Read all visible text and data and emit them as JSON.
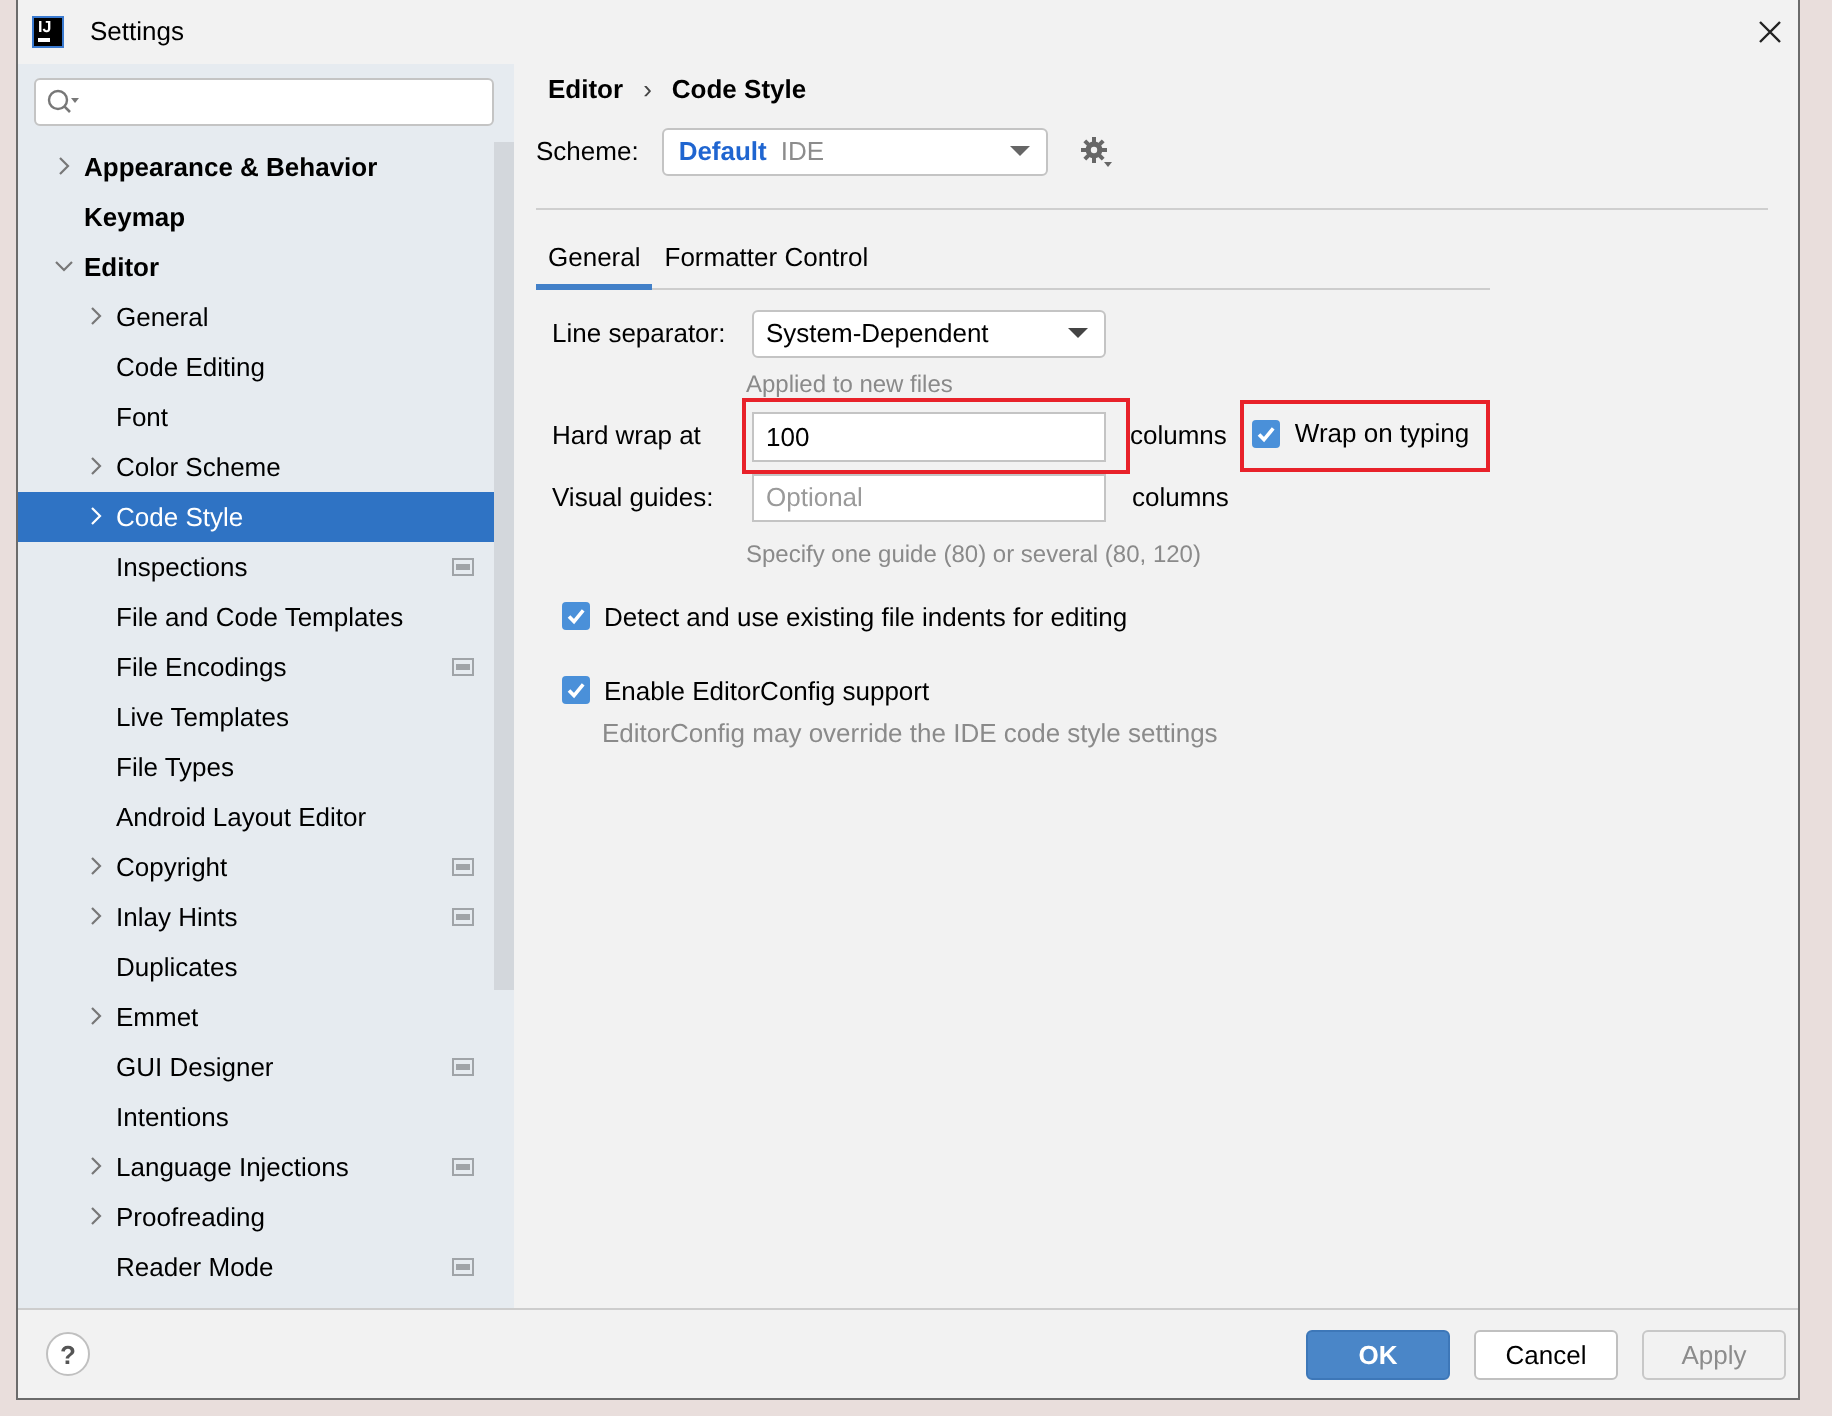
{
  "window": {
    "title": "Settings",
    "logo_text": "IJ"
  },
  "sidebar": {
    "items": [
      {
        "label": "Appearance & Behavior",
        "expandable": true,
        "expanded": false,
        "selected": false,
        "project_level": false
      },
      {
        "label": "Keymap",
        "expandable": false,
        "selected": false,
        "project_level": false
      },
      {
        "label": "Editor",
        "expandable": true,
        "expanded": true,
        "selected": false,
        "project_level": false,
        "children": [
          {
            "label": "General",
            "expandable": true,
            "expanded": false,
            "selected": false,
            "project_level": false
          },
          {
            "label": "Code Editing",
            "expandable": false,
            "selected": false,
            "project_level": false
          },
          {
            "label": "Font",
            "expandable": false,
            "selected": false,
            "project_level": false
          },
          {
            "label": "Color Scheme",
            "expandable": true,
            "expanded": false,
            "selected": false,
            "project_level": false
          },
          {
            "label": "Code Style",
            "expandable": true,
            "expanded": false,
            "selected": true,
            "project_level": false
          },
          {
            "label": "Inspections",
            "expandable": false,
            "selected": false,
            "project_level": true
          },
          {
            "label": "File and Code Templates",
            "expandable": false,
            "selected": false,
            "project_level": false
          },
          {
            "label": "File Encodings",
            "expandable": false,
            "selected": false,
            "project_level": true
          },
          {
            "label": "Live Templates",
            "expandable": false,
            "selected": false,
            "project_level": false
          },
          {
            "label": "File Types",
            "expandable": false,
            "selected": false,
            "project_level": false
          },
          {
            "label": "Android Layout Editor",
            "expandable": false,
            "selected": false,
            "project_level": false
          },
          {
            "label": "Copyright",
            "expandable": true,
            "expanded": false,
            "selected": false,
            "project_level": true
          },
          {
            "label": "Inlay Hints",
            "expandable": true,
            "expanded": false,
            "selected": false,
            "project_level": true
          },
          {
            "label": "Duplicates",
            "expandable": false,
            "selected": false,
            "project_level": false
          },
          {
            "label": "Emmet",
            "expandable": true,
            "expanded": false,
            "selected": false,
            "project_level": false
          },
          {
            "label": "GUI Designer",
            "expandable": false,
            "selected": false,
            "project_level": true
          },
          {
            "label": "Intentions",
            "expandable": false,
            "selected": false,
            "project_level": false
          },
          {
            "label": "Language Injections",
            "expandable": true,
            "expanded": false,
            "selected": false,
            "project_level": true
          },
          {
            "label": "Proofreading",
            "expandable": true,
            "expanded": false,
            "selected": false,
            "project_level": false
          },
          {
            "label": "Reader Mode",
            "expandable": false,
            "selected": false,
            "project_level": true
          }
        ]
      }
    ]
  },
  "breadcrumb": {
    "items": [
      "Editor",
      "Code Style"
    ],
    "separator": "›"
  },
  "scheme": {
    "label": "Scheme:",
    "value": "Default",
    "suffix": "IDE"
  },
  "tabs": [
    {
      "label": "General",
      "selected": true
    },
    {
      "label": "Formatter Control",
      "selected": false
    }
  ],
  "line_separator": {
    "label": "Line separator:",
    "value": "System-Dependent",
    "hint": "Applied to new files"
  },
  "hard_wrap": {
    "label": "Hard wrap at",
    "value": "100",
    "unit": "columns",
    "highlighted": true
  },
  "wrap_on_typing": {
    "label": "Wrap on typing",
    "checked": true,
    "highlighted": true
  },
  "visual_guides": {
    "label": "Visual guides:",
    "placeholder": "Optional",
    "unit": "columns",
    "hint": "Specify one guide (80) or several (80, 120)"
  },
  "options": [
    {
      "label": "Detect and use existing file indents for editing",
      "checked": true
    },
    {
      "label": "Enable EditorConfig support",
      "checked": true,
      "hint": "EditorConfig may override the IDE code style settings"
    }
  ],
  "help": "?",
  "buttons": [
    {
      "label": "OK",
      "kind": "primary",
      "disabled": false
    },
    {
      "label": "Cancel",
      "kind": "normal",
      "disabled": false
    },
    {
      "label": "Apply",
      "kind": "normal",
      "disabled": true
    }
  ]
}
